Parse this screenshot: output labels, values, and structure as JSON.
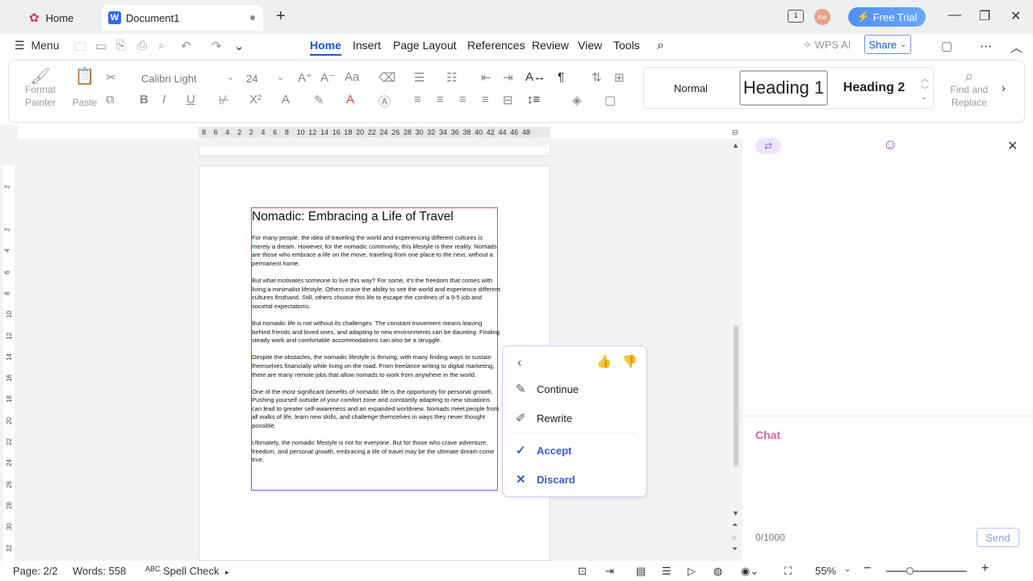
{
  "titlebar": {
    "home_tab": "Home",
    "doc_tab": "Document1",
    "doc_logo": "W",
    "avatar": "ma",
    "free_trial": "Free Trial"
  },
  "menubar": {
    "menu": "Menu",
    "tabs": [
      "Home",
      "Insert",
      "Page Layout",
      "References",
      "Review",
      "View",
      "Tools"
    ],
    "wps_ai": "WPS AI",
    "share": "Share"
  },
  "ribbon": {
    "format_painter": "Format\nPainter",
    "paste": "Paste",
    "font_name": "Calibri Light",
    "font_size": "24",
    "styles": [
      "Normal",
      "Heading 1",
      "Heading 2"
    ],
    "find_replace_1": "Find and",
    "find_replace_2": "Replace"
  },
  "hruler": [
    "8",
    "6",
    "4",
    "2",
    "2",
    "4",
    "6",
    "8",
    "10",
    "12",
    "14",
    "16",
    "18",
    "20",
    "22",
    "24",
    "26",
    "28",
    "30",
    "32",
    "34",
    "36",
    "38",
    "40",
    "42",
    "44",
    "46",
    "48"
  ],
  "vruler": [
    "2",
    "2",
    "4",
    "6",
    "8",
    "10",
    "12",
    "14",
    "16",
    "18",
    "20",
    "22",
    "24",
    "26",
    "28",
    "30",
    "32"
  ],
  "document": {
    "title": "Nomadic: Embracing a Life of Travel",
    "paragraphs": [
      "For many people, the idea of traveling the world and experiencing different cultures is merely a dream. However, for the nomadic community, this lifestyle is their reality. Nomads are those who embrace a life on the move, traveling from one place to the next, without a permanent home.",
      "But what motivates someone to live this way? For some, it's the freedom that comes with living a minimalist lifestyle. Others crave the ability to see the world and experience different cultures firsthand. Still, others choose this life to escape the confines of a 9-5 job and societal expectations.",
      "But nomadic life is not without its challenges. The constant movement means leaving behind friends and loved ones, and adapting to new environments can be daunting. Finding steady work and comfortable accommodations can also be a struggle.",
      "Despite the obstacles, the nomadic lifestyle is thriving, with many finding ways to sustain themselves financially while living on the road. From freelance writing to digital marketing, there are many remote jobs that allow nomads to work from anywhere in the world.",
      "One of the most significant benefits of nomadic life is the opportunity for personal growth. Pushing yourself outside of your comfort zone and constantly adapting to new situations can lead to greater self-awareness and an expanded worldview. Nomads meet people from all walks of life, learn new skills, and challenge themselves in ways they never thought possible.",
      "Ultimately, the nomadic lifestyle is not for everyone. But for those who crave adventure, freedom, and personal growth, embracing a life of travel may be the ultimate dream come true."
    ]
  },
  "popup": {
    "continue": "Continue",
    "rewrite": "Rewrite",
    "accept": "Accept",
    "discard": "Discard"
  },
  "aipanel": {
    "chat": "Chat",
    "counter": "0/1000",
    "send": "Send"
  },
  "statusbar": {
    "page": "Page: 2/2",
    "words": "Words: 558",
    "spell_check": "Spell Check",
    "zoom": "55%"
  },
  "colors": {
    "accent": "#1a56d6",
    "free_trial": "#4f8ff7",
    "chat_label": "#d66a9a",
    "textbox_border_top": "#e8465c",
    "textbox_border_bottom": "#9a4ee0"
  }
}
